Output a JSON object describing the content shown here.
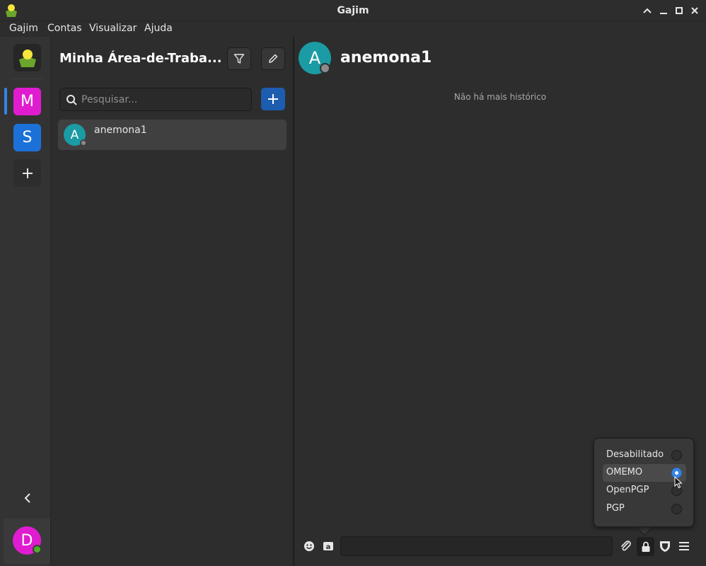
{
  "window": {
    "title": "Gajim"
  },
  "menubar": {
    "items": [
      "Gajim",
      "Contas",
      "Visualizar",
      "Ajuda"
    ]
  },
  "workspaces": {
    "items": [
      {
        "letter": "M",
        "color": "#e01cd0",
        "active": true
      },
      {
        "letter": "S",
        "color": "#1c71d8",
        "active": false
      }
    ],
    "account_avatar_letter": "D",
    "account_color": "#e01cd0",
    "account_status_color": "#4caf25"
  },
  "chatlist": {
    "title": "Minha Área-de-Traba...",
    "search_placeholder": "Pesquisar...",
    "chats": [
      {
        "name": "anemona1",
        "avatar_letter": "A",
        "avatar_color": "#1b9ba4"
      }
    ]
  },
  "conversation": {
    "contact_name": "anemona1",
    "contact_avatar_letter": "A",
    "no_history": "Não há mais histórico"
  },
  "encryption_popover": {
    "options": [
      "Desabilitado",
      "OMEMO",
      "OpenPGP",
      "PGP"
    ],
    "selected": "OMEMO"
  },
  "colors": {
    "accent": "#3584e4",
    "add_button": "#1c5db0",
    "background": "#2d2d2d"
  },
  "icons": [
    "gajim-logo-icon",
    "filter-icon",
    "pencil-icon",
    "search-icon",
    "plus-icon",
    "chevron-left-icon",
    "emoji-icon",
    "format-icon",
    "attach-icon",
    "lock-icon",
    "shield-icon",
    "menu-icon"
  ]
}
